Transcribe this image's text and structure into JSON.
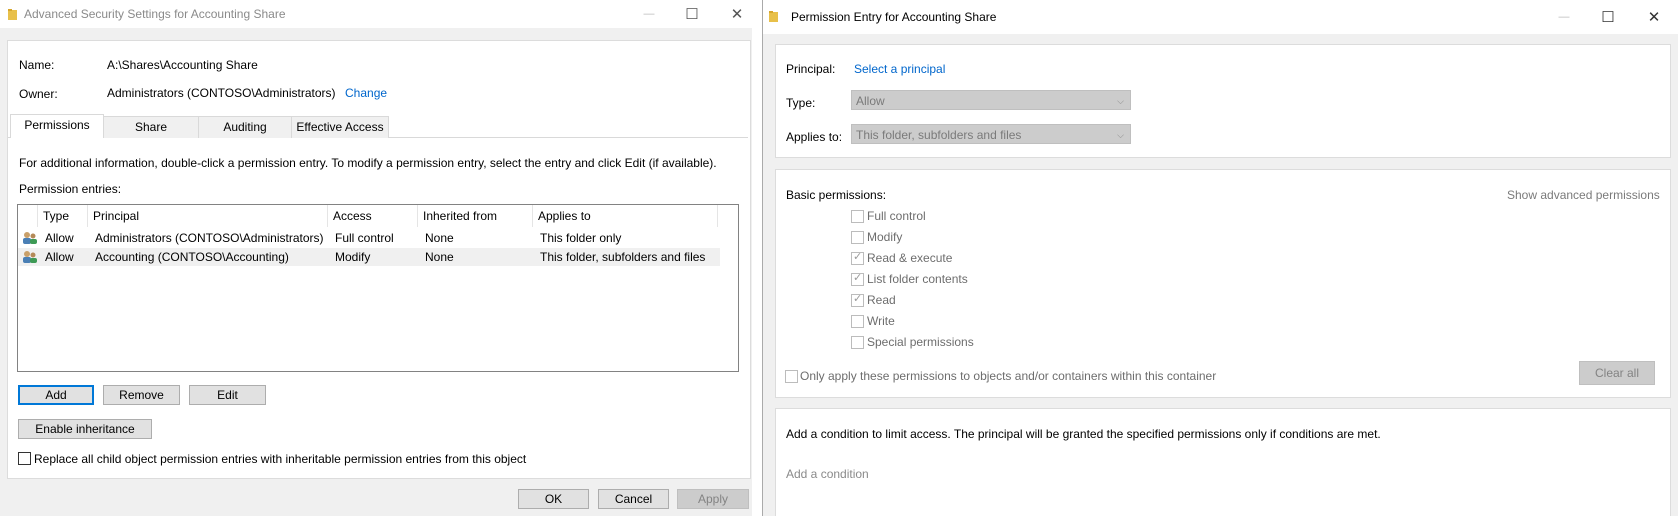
{
  "left_window": {
    "title": "Advanced Security Settings for Accounting Share",
    "controls": {
      "minimize": "—",
      "maximize": "☐",
      "close": "✕"
    },
    "name_label": "Name:",
    "name_value": "A:\\Shares\\Accounting Share",
    "owner_label": "Owner:",
    "owner_value": "Administrators (CONTOSO\\Administrators)",
    "change_link": "Change",
    "tabs": [
      {
        "label": "Permissions",
        "active": true
      },
      {
        "label": "Share",
        "active": false
      },
      {
        "label": "Auditing",
        "active": false
      },
      {
        "label": "Effective Access",
        "active": false
      }
    ],
    "info_text": "For additional information, double-click a permission entry. To modify a permission entry, select the entry and click Edit (if available).",
    "entries_label": "Permission entries:",
    "columns": [
      "Type",
      "Principal",
      "Access",
      "Inherited from",
      "Applies to"
    ],
    "rows": [
      {
        "icon": "users-icon",
        "type": "Allow",
        "principal": "Administrators (CONTOSO\\Administrators)",
        "access": "Full control",
        "inherited": "None",
        "applies": "This folder only",
        "selected": false
      },
      {
        "icon": "users-icon",
        "type": "Allow",
        "principal": "Accounting (CONTOSO\\Accounting)",
        "access": "Modify",
        "inherited": "None",
        "applies": "This folder, subfolders and files",
        "selected": true
      }
    ],
    "buttons": {
      "add": "Add",
      "remove": "Remove",
      "edit": "Edit",
      "enable_inheritance": "Enable inheritance",
      "ok": "OK",
      "cancel": "Cancel",
      "apply": "Apply"
    },
    "replace_checkbox_label": "Replace all child object permission entries with inheritable permission entries from this object",
    "replace_checked": false
  },
  "right_window": {
    "title": "Permission Entry for Accounting Share",
    "controls": {
      "minimize": "—",
      "maximize": "☐",
      "close": "✕"
    },
    "principal_label": "Principal:",
    "principal_link": "Select a principal",
    "type_label": "Type:",
    "type_value": "Allow",
    "applies_label": "Applies to:",
    "applies_value": "This folder, subfolders and files",
    "basic_permissions_label": "Basic permissions:",
    "show_advanced_link": "Show advanced permissions",
    "permissions": [
      {
        "label": "Full control",
        "checked": false
      },
      {
        "label": "Modify",
        "checked": false
      },
      {
        "label": "Read & execute",
        "checked": true
      },
      {
        "label": "List folder contents",
        "checked": true
      },
      {
        "label": "Read",
        "checked": true
      },
      {
        "label": "Write",
        "checked": false
      },
      {
        "label": "Special permissions",
        "checked": false
      }
    ],
    "only_apply_label": "Only apply these permissions to objects and/or containers within this container",
    "clear_all": "Clear all",
    "condition_text": "Add a condition to limit access. The principal will be granted the specified permissions only if conditions are met.",
    "add_condition_link": "Add a condition"
  },
  "colors": {
    "link": "#0066cc",
    "focus": "#0078d7",
    "window_bg": "#f0f0f0"
  }
}
